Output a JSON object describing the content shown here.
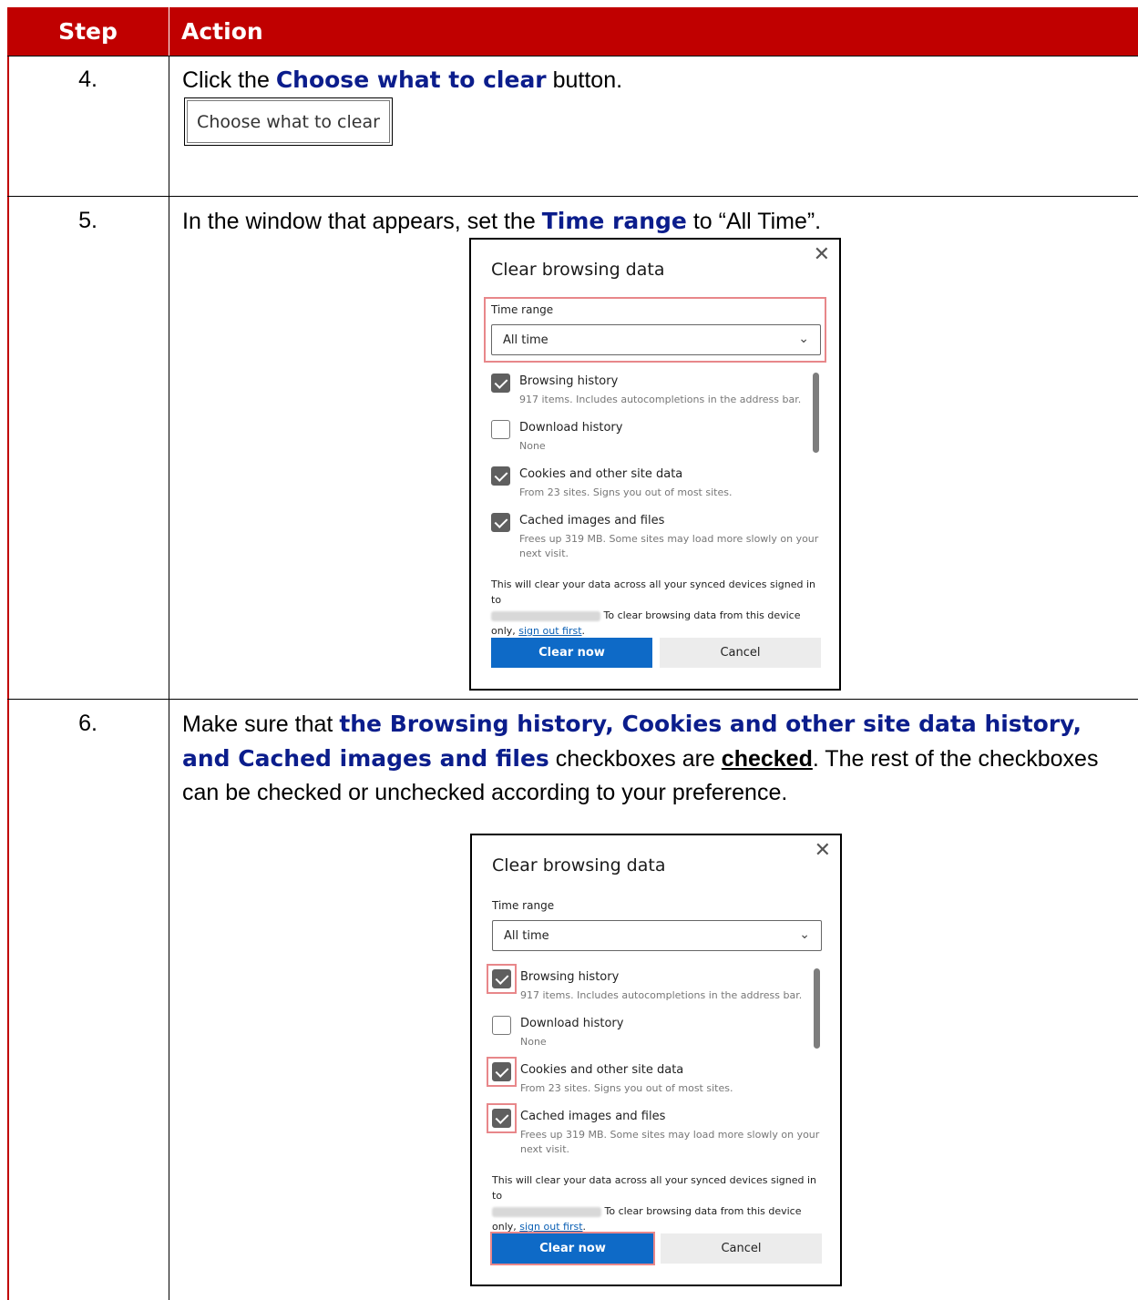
{
  "header": {
    "step": "Step",
    "action": "Action"
  },
  "rows": [
    {
      "step": "4.",
      "pre": "Click the ",
      "highlight": "Choose what to clear",
      "post": " button.",
      "button_label": "Choose what to clear"
    },
    {
      "step": "5.",
      "pre": "In the window that appears, set the ",
      "highlight": "Time range",
      "post": " to “All Time”."
    },
    {
      "step": "6.",
      "pre": "Make sure that ",
      "highlight": "the Browsing history, Cookies and other site data history, and Cached images and files",
      "mid": " checkboxes are ",
      "emph": "checked",
      "post": ".  The rest of the checkboxes can be checked or unchecked according to your preference."
    }
  ],
  "dialog": {
    "title": "Clear browsing data",
    "close_glyph": "✕",
    "time_range_label": "Time range",
    "time_range_value": "All time",
    "items": [
      {
        "label": "Browsing history",
        "sub": "917 items. Includes autocompletions in the address bar.",
        "checked": true
      },
      {
        "label": "Download history",
        "sub": "None",
        "checked": false
      },
      {
        "label": "Cookies and other site data",
        "sub": "From 23 sites. Signs you out of most sites.",
        "checked": true
      },
      {
        "label": "Cached images and files",
        "sub": "Frees up 319 MB. Some sites may load more slowly on your next visit.",
        "checked": true
      }
    ],
    "note_line1": "This will clear your data across all your synced devices signed in to",
    "note_line2": " To clear browsing data from this device",
    "note_line3_pre": "only, ",
    "note_link": "sign out first",
    "note_line3_post": ".",
    "clear_label": "Clear now",
    "cancel_label": "Cancel"
  }
}
